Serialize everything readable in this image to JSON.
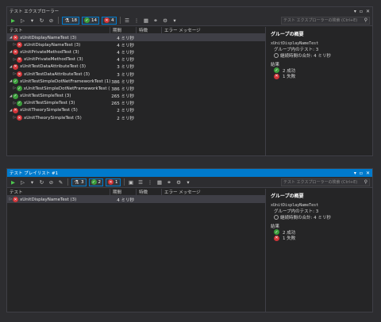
{
  "explorer": {
    "title": "テスト エクスプローラー",
    "window_controls": [
      "▾",
      "▫",
      "✕"
    ],
    "counters": {
      "total": "18",
      "passed": "14",
      "failed": "4"
    },
    "search_placeholder": "テスト エクスプローラーの検索 (Ctrl+E)",
    "columns": {
      "test": "テスト",
      "duration": "期間",
      "traits": "特徴",
      "error": "エラー メッセージ"
    },
    "rows": [
      {
        "level": 0,
        "expand": "◢",
        "status": "fail",
        "name": "xUnitDisplayNameTest (3)",
        "duration": "4 ミリ秒",
        "selected": true
      },
      {
        "level": 1,
        "expand": "▷",
        "status": "fail",
        "name": "xUnitDisplayNameTest (3)",
        "duration": "4 ミリ秒"
      },
      {
        "level": 0,
        "expand": "◢",
        "status": "fail",
        "name": "xUnitPrivateMethodTest (3)",
        "duration": "4 ミリ秒"
      },
      {
        "level": 1,
        "expand": "▷",
        "status": "fail",
        "name": "xUnitPrivateMethodTest (3)",
        "duration": "4 ミリ秒"
      },
      {
        "level": 0,
        "expand": "◢",
        "status": "fail",
        "name": "xUnitTestDataAttributeTest (3)",
        "duration": "3 ミリ秒"
      },
      {
        "level": 1,
        "expand": "▷",
        "status": "fail",
        "name": "xUnitTestDataAttributeTest (3)",
        "duration": "3 ミリ秒"
      },
      {
        "level": 0,
        "expand": "◢",
        "status": "pass",
        "name": "xUnitTestSimpleDotNetFrameworkTest (1)",
        "duration": "386 ミリ秒"
      },
      {
        "level": 1,
        "expand": "▷",
        "status": "pass",
        "name": "xUnitTestSimpleDotNetFrameworkTest (...",
        "duration": "386 ミリ秒"
      },
      {
        "level": 0,
        "expand": "◢",
        "status": "pass",
        "name": "xUnitTestSimpleTest (3)",
        "duration": "265 ミリ秒"
      },
      {
        "level": 1,
        "expand": "▷",
        "status": "pass",
        "name": "xUnitTestSimpleTest (3)",
        "duration": "265 ミリ秒"
      },
      {
        "level": 0,
        "expand": "◢",
        "status": "fail",
        "name": "xUnitTheorySimpleTest (5)",
        "duration": "2 ミリ秒"
      },
      {
        "level": 1,
        "expand": "▷",
        "status": "fail",
        "name": "xUnitTheorySimpleTest (5)",
        "duration": "2 ミリ秒"
      }
    ],
    "detail": {
      "title": "グループの概要",
      "group_name": "xUnitDisplayNameTest",
      "test_count": "グループ内のテスト: 3",
      "total_time": "継続時間の合計: 4 ミリ秒",
      "results_label": "結果",
      "passed": "2 成功",
      "failed": "1 失敗"
    }
  },
  "playlist": {
    "title": "テスト プレイリスト #1",
    "window_controls": [
      "▾",
      "▫",
      "✕"
    ],
    "counters": {
      "total": "3",
      "passed": "2",
      "failed": "1"
    },
    "search_placeholder": "テスト エクスプローラーの検索 (Ctrl+E)",
    "columns": {
      "test": "テスト",
      "duration": "期間",
      "traits": "特徴",
      "error": "エラー メッセージ"
    },
    "rows": [
      {
        "level": 0,
        "expand": "▷",
        "status": "fail",
        "name": "xUnitDisplayNameTest (3)",
        "duration": "4 ミリ秒",
        "selected": true
      }
    ],
    "detail": {
      "title": "グループの概要",
      "group_name": "xUnitDisplayNameTest",
      "test_count": "グループ内のテスト: 3",
      "total_time": "継続時間の合計: 4 ミリ秒",
      "results_label": "結果",
      "passed": "2 成功",
      "failed": "1 失敗"
    }
  }
}
